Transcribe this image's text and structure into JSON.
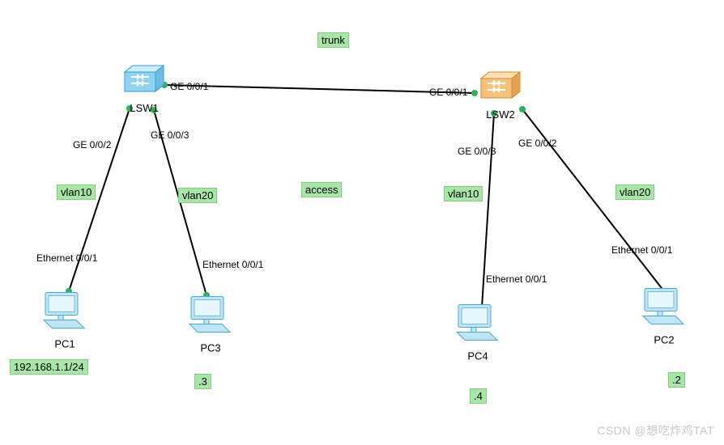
{
  "chart_data": {
    "type": "network-topology",
    "title": "",
    "tags": {
      "trunk": "trunk",
      "access": "access",
      "vlan10_left": "vlan10",
      "vlan20_left": "vlan20",
      "vlan10_right": "vlan10",
      "vlan20_right": "vlan20"
    },
    "switches": {
      "LSW1": {
        "label": "LSW1",
        "ports": {
          "g001": "GE 0/0/1",
          "g002": "GE 0/0/2",
          "g003": "GE 0/0/3"
        }
      },
      "LSW2": {
        "label": "LSW2",
        "ports": {
          "g001": "GE 0/0/1",
          "g002": "GE 0/0/2",
          "g003": "GE 0/0/3"
        }
      }
    },
    "pcs": {
      "PC1": {
        "label": "PC1",
        "port": "Ethernet 0/0/1",
        "addr": "192.168.1.1/24"
      },
      "PC3": {
        "label": "PC3",
        "port": "Ethernet 0/0/1",
        "addr": ".3"
      },
      "PC4": {
        "label": "PC4",
        "port": "Ethernet 0/0/1",
        "addr": ".4"
      },
      "PC2": {
        "label": "PC2",
        "port": "Ethernet 0/0/1",
        "addr": ".2"
      }
    },
    "links": [
      {
        "from": "LSW1 GE0/0/1",
        "to": "LSW2 GE0/0/1",
        "role": "trunk"
      },
      {
        "from": "LSW1 GE0/0/2",
        "to": "PC1 Ethernet0/0/1",
        "role": "access",
        "vlan": 10
      },
      {
        "from": "LSW1 GE0/0/3",
        "to": "PC3 Ethernet0/0/1",
        "role": "access",
        "vlan": 20
      },
      {
        "from": "LSW2 GE0/0/3",
        "to": "PC4 Ethernet0/0/1",
        "role": "access",
        "vlan": 10
      },
      {
        "from": "LSW2 GE0/0/2",
        "to": "PC2 Ethernet0/0/1",
        "role": "access",
        "vlan": 20
      }
    ]
  },
  "watermark": "CSDN @想吃炸鸡TAT"
}
